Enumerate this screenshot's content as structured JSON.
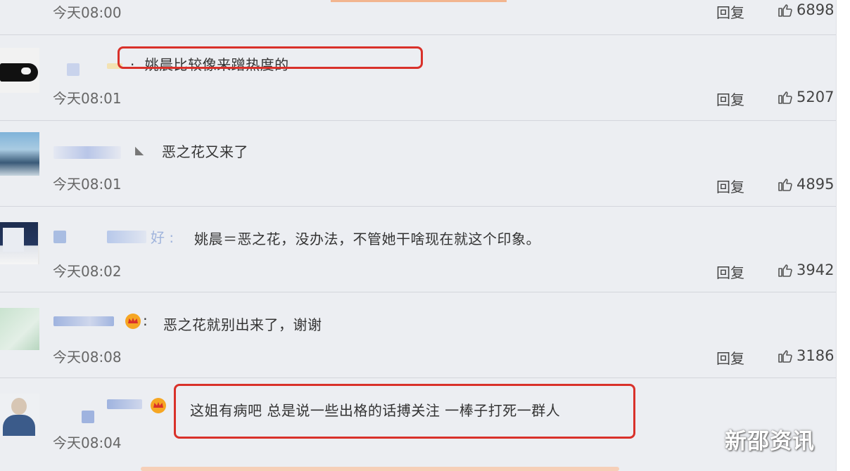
{
  "watermark": "新邵资讯",
  "comments": [
    {
      "text": "",
      "time": "今天08:00",
      "reply": "回复",
      "likes": "6898"
    },
    {
      "text": "姚晨比较像来蹭热度的",
      "time": "今天08:01",
      "reply": "回复",
      "likes": "5207"
    },
    {
      "text": "恶之花又来了",
      "time": "今天08:01",
      "reply": "回复",
      "likes": "4895"
    },
    {
      "text": "姚晨＝恶之花，没办法，不管她干啥现在就这个印象。",
      "time": "今天08:02",
      "reply": "回复",
      "likes": "3942"
    },
    {
      "text": "恶之花就别出来了，谢谢",
      "time": "今天08:08",
      "reply": "回复",
      "likes": "3186"
    },
    {
      "text": "这姐有病吧 总是说一些出格的话搏关注 一棒子打死一群人",
      "time": "今天08:04",
      "reply": "回复",
      "likes": ""
    }
  ],
  "colors": {
    "highlight": "#d9312a",
    "background": "#eceef2"
  }
}
